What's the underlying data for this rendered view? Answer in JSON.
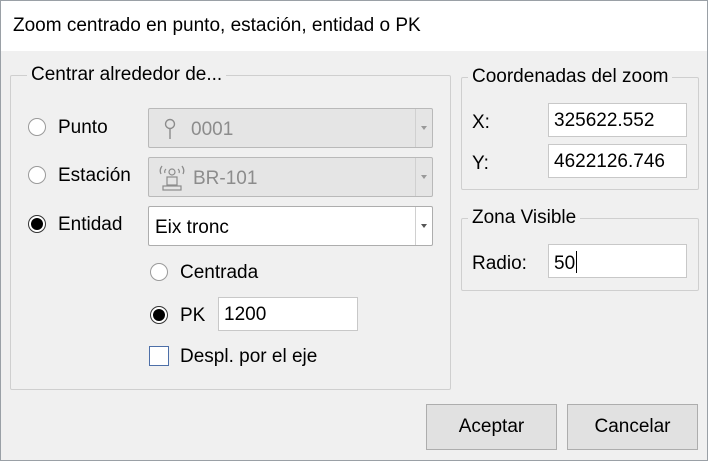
{
  "window": {
    "title": "Zoom centrado en punto, estación, entidad o PK"
  },
  "center_group": {
    "legend": "Centrar alrededor de...",
    "options": [
      {
        "label": "Punto",
        "selected": false,
        "value": "0001",
        "icon": "pin-icon"
      },
      {
        "label": "Estación",
        "selected": false,
        "value": "BR-101",
        "icon": "station-icon"
      },
      {
        "label": "Entidad",
        "selected": true,
        "value": "Eix tronc"
      }
    ],
    "entity_options": {
      "centered_label": "Centrada",
      "centered_selected": false,
      "pk_label": "PK",
      "pk_selected": true,
      "pk_value": "1200",
      "offset_label": "Despl. por el eje",
      "offset_checked": false
    }
  },
  "coords_group": {
    "legend": "Coordenadas del zoom",
    "x_label": "X:",
    "x_value": "325622.552",
    "y_label": "Y:",
    "y_value": "4622126.746"
  },
  "visible_group": {
    "legend": "Zona Visible",
    "radius_label": "Radio:",
    "radius_value": "50"
  },
  "buttons": {
    "accept": "Aceptar",
    "cancel": "Cancelar"
  },
  "colors": {
    "checkbox_border": "#4d6fa8",
    "disabled_combo": "#e5e5e5"
  }
}
